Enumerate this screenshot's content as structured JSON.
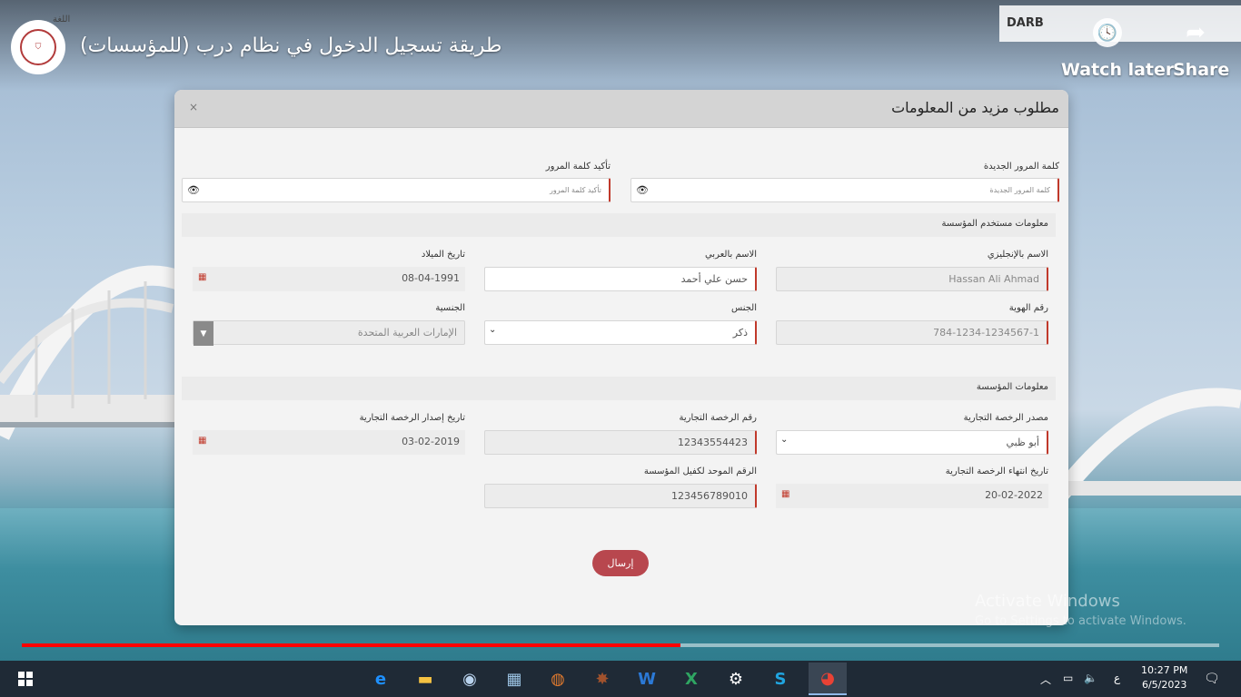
{
  "video": {
    "title": "طريقة تسجيل الدخول في نظام درب (للمؤسسات)",
    "watch_later": "Watch later",
    "share": "Share",
    "brand": "DARB",
    "language_toggle": "اللغة",
    "progress_percent": 55
  },
  "modal": {
    "title": "مطلوب مزيد من المعلومات",
    "close": "×",
    "password": {
      "new_label": "كلمة المرور الجديدة",
      "new_placeholder": "كلمة المرور الجديدة",
      "confirm_label": "تأكيد كلمة المرور",
      "confirm_placeholder": "تأكيد كلمة المرور"
    },
    "user_section": {
      "title": "معلومات مستخدم المؤسسة",
      "name_en_label": "الاسم بالإنجليزي",
      "name_en_value": "Hassan Ali Ahmad",
      "name_ar_label": "الاسم بالعربي",
      "name_ar_value": "حسن علي أحمد",
      "dob_label": "تاريخ الميلاد",
      "dob_value": "08-04-1991",
      "id_label": "رقم الهوية",
      "id_value": "784-1234-1234567-1",
      "gender_label": "الجنس",
      "gender_value": "ذكر",
      "nationality_label": "الجنسية",
      "nationality_value": "الإمارات العربية المتحدة"
    },
    "org_section": {
      "title": "معلومات المؤسسة",
      "license_source_label": "مصدر الرخصة التجارية",
      "license_source_value": "أبو ظبي",
      "license_number_label": "رقم الرخصة التجارية",
      "license_number_value": "12343554423",
      "license_issue_label": "تاريخ إصدار الرخصة التجارية",
      "license_issue_value": "03-02-2019",
      "license_expiry_label": "تاريخ انتهاء الرخصة التجارية",
      "license_expiry_value": "20-02-2022",
      "unified_number_label": "الرقم الموحد لكفيل المؤسسة",
      "unified_number_value": "123456789010"
    },
    "submit": "إرسال"
  },
  "watermark": {
    "line1": "Activate Windows",
    "line2": "Go to Settings to activate Windows."
  },
  "taskbar": {
    "time": "10:27 PM",
    "date": "6/5/2023",
    "ime": "ع",
    "icons": [
      "start-icon",
      "edge-icon",
      "file-explorer-icon",
      "globe-app-icon",
      "media-app-icon",
      "app-icon",
      "game-icon",
      "word-icon",
      "excel-icon",
      "settings-icon",
      "skype-icon",
      "chrome-icon"
    ]
  }
}
